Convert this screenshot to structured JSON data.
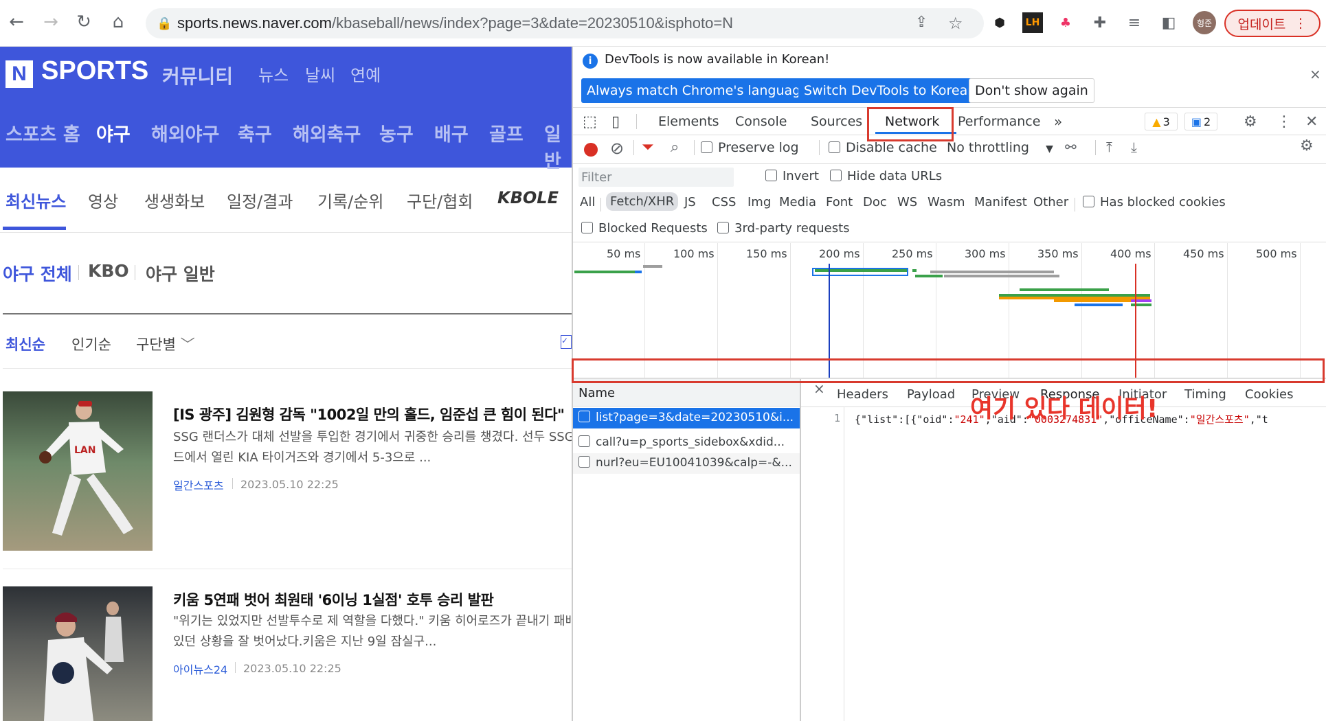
{
  "browser": {
    "url_host": "sports.news.naver.com",
    "url_path": "/kbaseball/news/index?page=3&date=20230510&isphoto=N",
    "update_label": "업데이트",
    "profile_label": "형준"
  },
  "naver": {
    "logo": "N",
    "brand": "SPORTS",
    "top_links": [
      "커뮤니티",
      "뉴스",
      "날씨",
      "연예"
    ],
    "main_nav": [
      "스포츠 홈",
      "야구",
      "해외야구",
      "축구",
      "해외축구",
      "농구",
      "배구",
      "골프",
      "일반"
    ],
    "tabs": [
      "최신뉴스",
      "영상",
      "생생화보",
      "일정/결과",
      "기록/순위",
      "구단/협회",
      "KBOLE"
    ],
    "sub_tabs": [
      "야구 전체",
      "KBO",
      "야구 일반"
    ],
    "sorts": [
      "최신순",
      "인기순",
      "구단별"
    ],
    "articles": [
      {
        "title": "[IS 광주] 김원형 감독 \"1002일 만의 홀드, 임준섭 큰 힘이 된다\"",
        "summary_1": "SSG 랜더스가 대체 선발을 투입한 경기에서 귀중한 승리를 챙겼다. 선두 SSG는",
        "summary_2": "드에서 열린 KIA 타이거즈와 경기에서 5-3으로 ...",
        "source": "일간스포츠",
        "date": "2023.05.10 22:25"
      },
      {
        "title": "키움 5연패 벗어 최원태 '6이닝 1실점' 호투 승리 발판",
        "summary_1": "\"위기는 있었지만 선발투수로 제 역할을 다했다.\" 키움 히어로즈가 끝내기 패배로",
        "summary_2": "있던 상황을 잘 벗어났다.키움은 지난 9일 잠실구...",
        "source": "아이뉴스24",
        "date": "2023.05.10 22:25"
      }
    ]
  },
  "devtools": {
    "notice": "DevTools is now available in Korean!",
    "btn_match": "Always match Chrome's language",
    "btn_switch": "Switch DevTools to Korean",
    "btn_dont": "Don't show again",
    "tabs": [
      "Elements",
      "Console",
      "Sources",
      "Network",
      "Performance"
    ],
    "warn_count": "3",
    "msg_count": "2",
    "preserve_log": "Preserve log",
    "disable_cache": "Disable cache",
    "throttling": "No throttling",
    "filter_placeholder": "Filter",
    "invert": "Invert",
    "hide_data_urls": "Hide data URLs",
    "type_filters": [
      "All",
      "Fetch/XHR",
      "JS",
      "CSS",
      "Img",
      "Media",
      "Font",
      "Doc",
      "WS",
      "Wasm",
      "Manifest",
      "Other"
    ],
    "blocked_cookies": "Has blocked cookies",
    "blocked_requests": "Blocked Requests",
    "third_party": "3rd-party requests",
    "timeline_ticks": [
      "50 ms",
      "100 ms",
      "150 ms",
      "200 ms",
      "250 ms",
      "300 ms",
      "350 ms",
      "400 ms",
      "450 ms",
      "500 ms"
    ],
    "name_header": "Name",
    "detail_tabs": [
      "Headers",
      "Payload",
      "Preview",
      "Response",
      "Initiator",
      "Timing",
      "Cookies"
    ],
    "requests": [
      "list?page=3&date=20230510&i...",
      "call?u=p_sports_sidebox&xdid...",
      "nurl?eu=EU10041039&calp=-&..."
    ],
    "response_line_no": "1",
    "response_parts": [
      "{\"list\":[{\"oid\":",
      "\"241\"",
      ",\"aid\":",
      "\"0003274831\"",
      ",\"officeName\":",
      "\"일간스포츠\"",
      ",\"t"
    ],
    "annotation": "여기 있다 데이터!"
  }
}
